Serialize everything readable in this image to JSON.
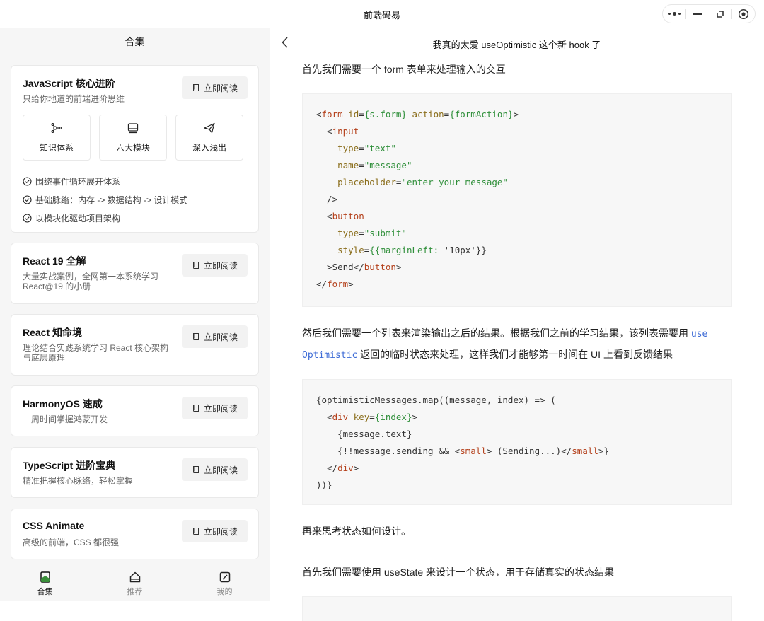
{
  "window": {
    "title": "前端码易"
  },
  "sidebar": {
    "header": "合集",
    "read_label": "立即阅读",
    "cards": [
      {
        "title": "JavaScript 核心进阶",
        "desc": "只给你地道的前端进阶思维",
        "features": [
          "知识体系",
          "六大模块",
          "深入浅出"
        ],
        "checks": [
          "围绕事件循环展开体系",
          "基础脉络：内存 -> 数据结构 -> 设计模式",
          "以模块化驱动项目架构"
        ]
      },
      {
        "title": "React 19 全解",
        "desc": "大量实战案例，全网第一本系统学习 React@19 的小册"
      },
      {
        "title": "React 知命境",
        "desc": "理论结合实践系统学习 React 核心架构与底层原理"
      },
      {
        "title": "HarmonyOS 速成",
        "desc": "一周时间掌握鸿蒙开发"
      },
      {
        "title": "TypeScript 进阶宝典",
        "desc": "精准把握核心脉络，轻松掌握"
      },
      {
        "title": "CSS Animate",
        "desc": "高级的前端，CSS 都很强"
      }
    ]
  },
  "bottom_nav": [
    {
      "label": "合集",
      "icon": "book-icon",
      "active": true
    },
    {
      "label": "推荐",
      "icon": "home-icon",
      "active": false
    },
    {
      "label": "我的",
      "icon": "edit-icon",
      "active": false
    }
  ],
  "article": {
    "title": "我真的太爱 useOptimistic 这个新 hook 了",
    "p1": "首先我们需要一个 form 表单来处理输入的交互",
    "p2_a": "然后我们需要一个列表来渲染输出之后的结果。根据我们之前的学习结果，该列表需要用 ",
    "p2_code1": "use",
    "p2_code2": "Optimistic",
    "p2_b": " 返回的临时状态来处理，这样我们才能够第一时间在 UI 上看到反馈结果",
    "p3": "再来思考状态如何设计。",
    "p4": "首先我们需要使用 useState 来设计一个状态，用于存储真实的状态结果"
  }
}
